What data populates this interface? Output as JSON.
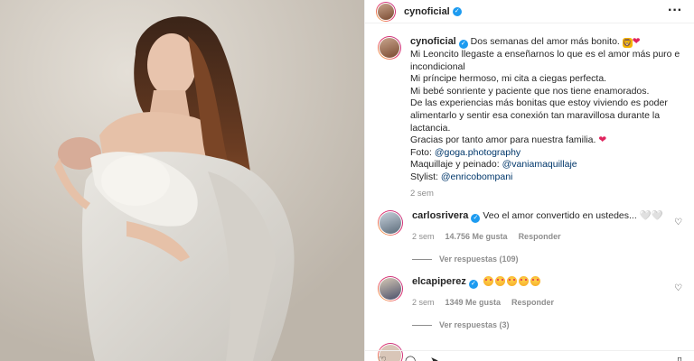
{
  "header": {
    "username": "cynoficial",
    "more_icon": "more-horizontal-icon"
  },
  "caption": {
    "username": "cynoficial",
    "lines": [
      "Dos semanas del amor más bonito.",
      "Mi Leoncito llegaste a enseñarnos lo que es el amor más puro e",
      "incondicional",
      "Mi príncipe hermoso, mi cita a ciegas perfecta.",
      "Mi bebé sonriente y paciente que nos tiene enamorados.",
      "De las experiencias más bonitas que estoy viviendo es poder",
      "alimentarlo y sentir esa conexión tan maravillosa durante la",
      "lactancia.",
      "Gracias por tanto amor para nuestra familia."
    ],
    "foto_label": "Foto:",
    "foto_link": "@goga.photography",
    "maquillaje_label": "Maquillaje y peinado:",
    "maquillaje_link": "@vaniamaquillaje",
    "stylist_label": "Stylist:",
    "stylist_link": "@enricobompani",
    "time": "2 sem"
  },
  "comments": [
    {
      "username": "carlosrivera",
      "text": "Veo el amor convertido en ustedes... 🤍🤍",
      "time": "2 sem",
      "likes": "14.756 Me gusta",
      "reply": "Responder",
      "view_replies": "Ver respuestas (109)"
    },
    {
      "username": "elcapiperez",
      "text": "",
      "time": "2 sem",
      "likes": "1349 Me gusta",
      "reply": "Responder",
      "view_replies": "Ver respuestas (3)"
    }
  ],
  "colors": {
    "verified": "#1d9bf0",
    "link": "#00376b",
    "muted": "#8e8e8e",
    "heart": "#e0245e"
  }
}
